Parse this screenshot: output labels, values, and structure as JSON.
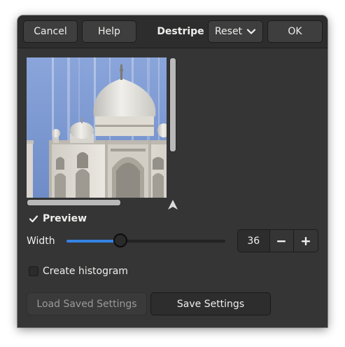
{
  "header": {
    "cancel_label": "Cancel",
    "help_label": "Help",
    "title": "Destripe",
    "reset_label": "Reset",
    "ok_label": "OK"
  },
  "preview": {
    "label": "Preview",
    "checked": true
  },
  "width": {
    "label": "Width",
    "value": "36",
    "slider_fraction": 0.34,
    "decrement_icon": "minus-icon",
    "increment_icon": "plus-icon"
  },
  "histogram": {
    "label": "Create histogram",
    "checked": false
  },
  "footer": {
    "load_label": "Load Saved Settings",
    "save_label": "Save Settings"
  },
  "colors": {
    "window_bg": "#353535",
    "accent": "#3584e4",
    "sky": "#7f9bd3",
    "marble": "#e6e4de"
  },
  "icons": {
    "reset_dropdown": "chevron-down-icon",
    "navigate": "navigate-arrow-icon",
    "check": "checkmark-icon"
  }
}
